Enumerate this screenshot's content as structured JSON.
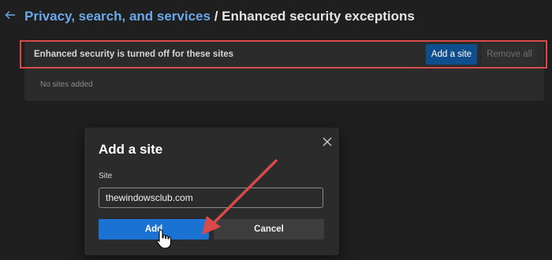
{
  "header": {
    "back_icon": "back-arrow-icon",
    "breadcrumb_link": "Privacy, search, and services",
    "separator": " / ",
    "page_title": "Enhanced security exceptions"
  },
  "card": {
    "title": "Enhanced security is turned off for these sites",
    "add_site_label": "Add a site",
    "remove_all_label": "Remove all",
    "empty_text": "No sites added"
  },
  "dialog": {
    "title": "Add a site",
    "close_icon": "close-icon",
    "field_label": "Site",
    "input_value": "thewindowsclub.com",
    "add_label": "Add",
    "cancel_label": "Cancel"
  },
  "colors": {
    "accent": "#1a73d2",
    "link": "#6aa8e8",
    "annotation": "#d94a4a"
  }
}
